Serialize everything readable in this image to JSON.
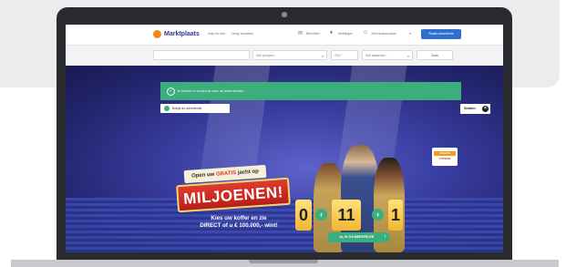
{
  "app": {
    "logo_text": "Marktplaats",
    "nav_links": [
      "Hulp en Info",
      "Hoog Yerzaken"
    ],
    "top_actions": [
      {
        "icon": "chat-icon",
        "label": "Berichten"
      },
      {
        "icon": "bell-icon",
        "label": "Meldingen"
      },
      {
        "icon": "user-icon",
        "label": "Jehunmarscuipad"
      }
    ],
    "cta_label": "Plaats advertentie"
  },
  "search": {
    "query_value": "",
    "category_placeholder": "Alle groepen...",
    "postcode_value": "2017",
    "distance_placeholder": "Alle afstanden...",
    "submit_label": "Zoek"
  },
  "notice": {
    "text": "Je bericht is verstuurd naar de adverteerder.",
    "icon": "check-circle-icon"
  },
  "view_ad": {
    "label": "Bekijk de advertentie",
    "icon": "arrow-circle-icon"
  },
  "close": {
    "label": "Sluiten",
    "icon": "close-icon"
  },
  "promo": {
    "banner_prefix": "Open uw",
    "banner_highlight": "GRATIS",
    "banner_suffix": "jacht op",
    "headline": "MILJOENEN!",
    "sub_line1": "Kies uw koffer en zie",
    "sub_line2": "DIRECT of u € 100.000,- wint!",
    "counter_values": [
      "0",
      "11",
      "1"
    ],
    "cta_label": "JA, IK GA MEESPELEN",
    "sponsor_line1": "STAATS",
    "sponsor_line2": "LOTERIJ"
  },
  "colors": {
    "accent_green": "#3cae7e",
    "brand_blue": "#2f6fd0",
    "headline_red": "#e23b2e",
    "stage_purple": "#3a3fa3"
  }
}
